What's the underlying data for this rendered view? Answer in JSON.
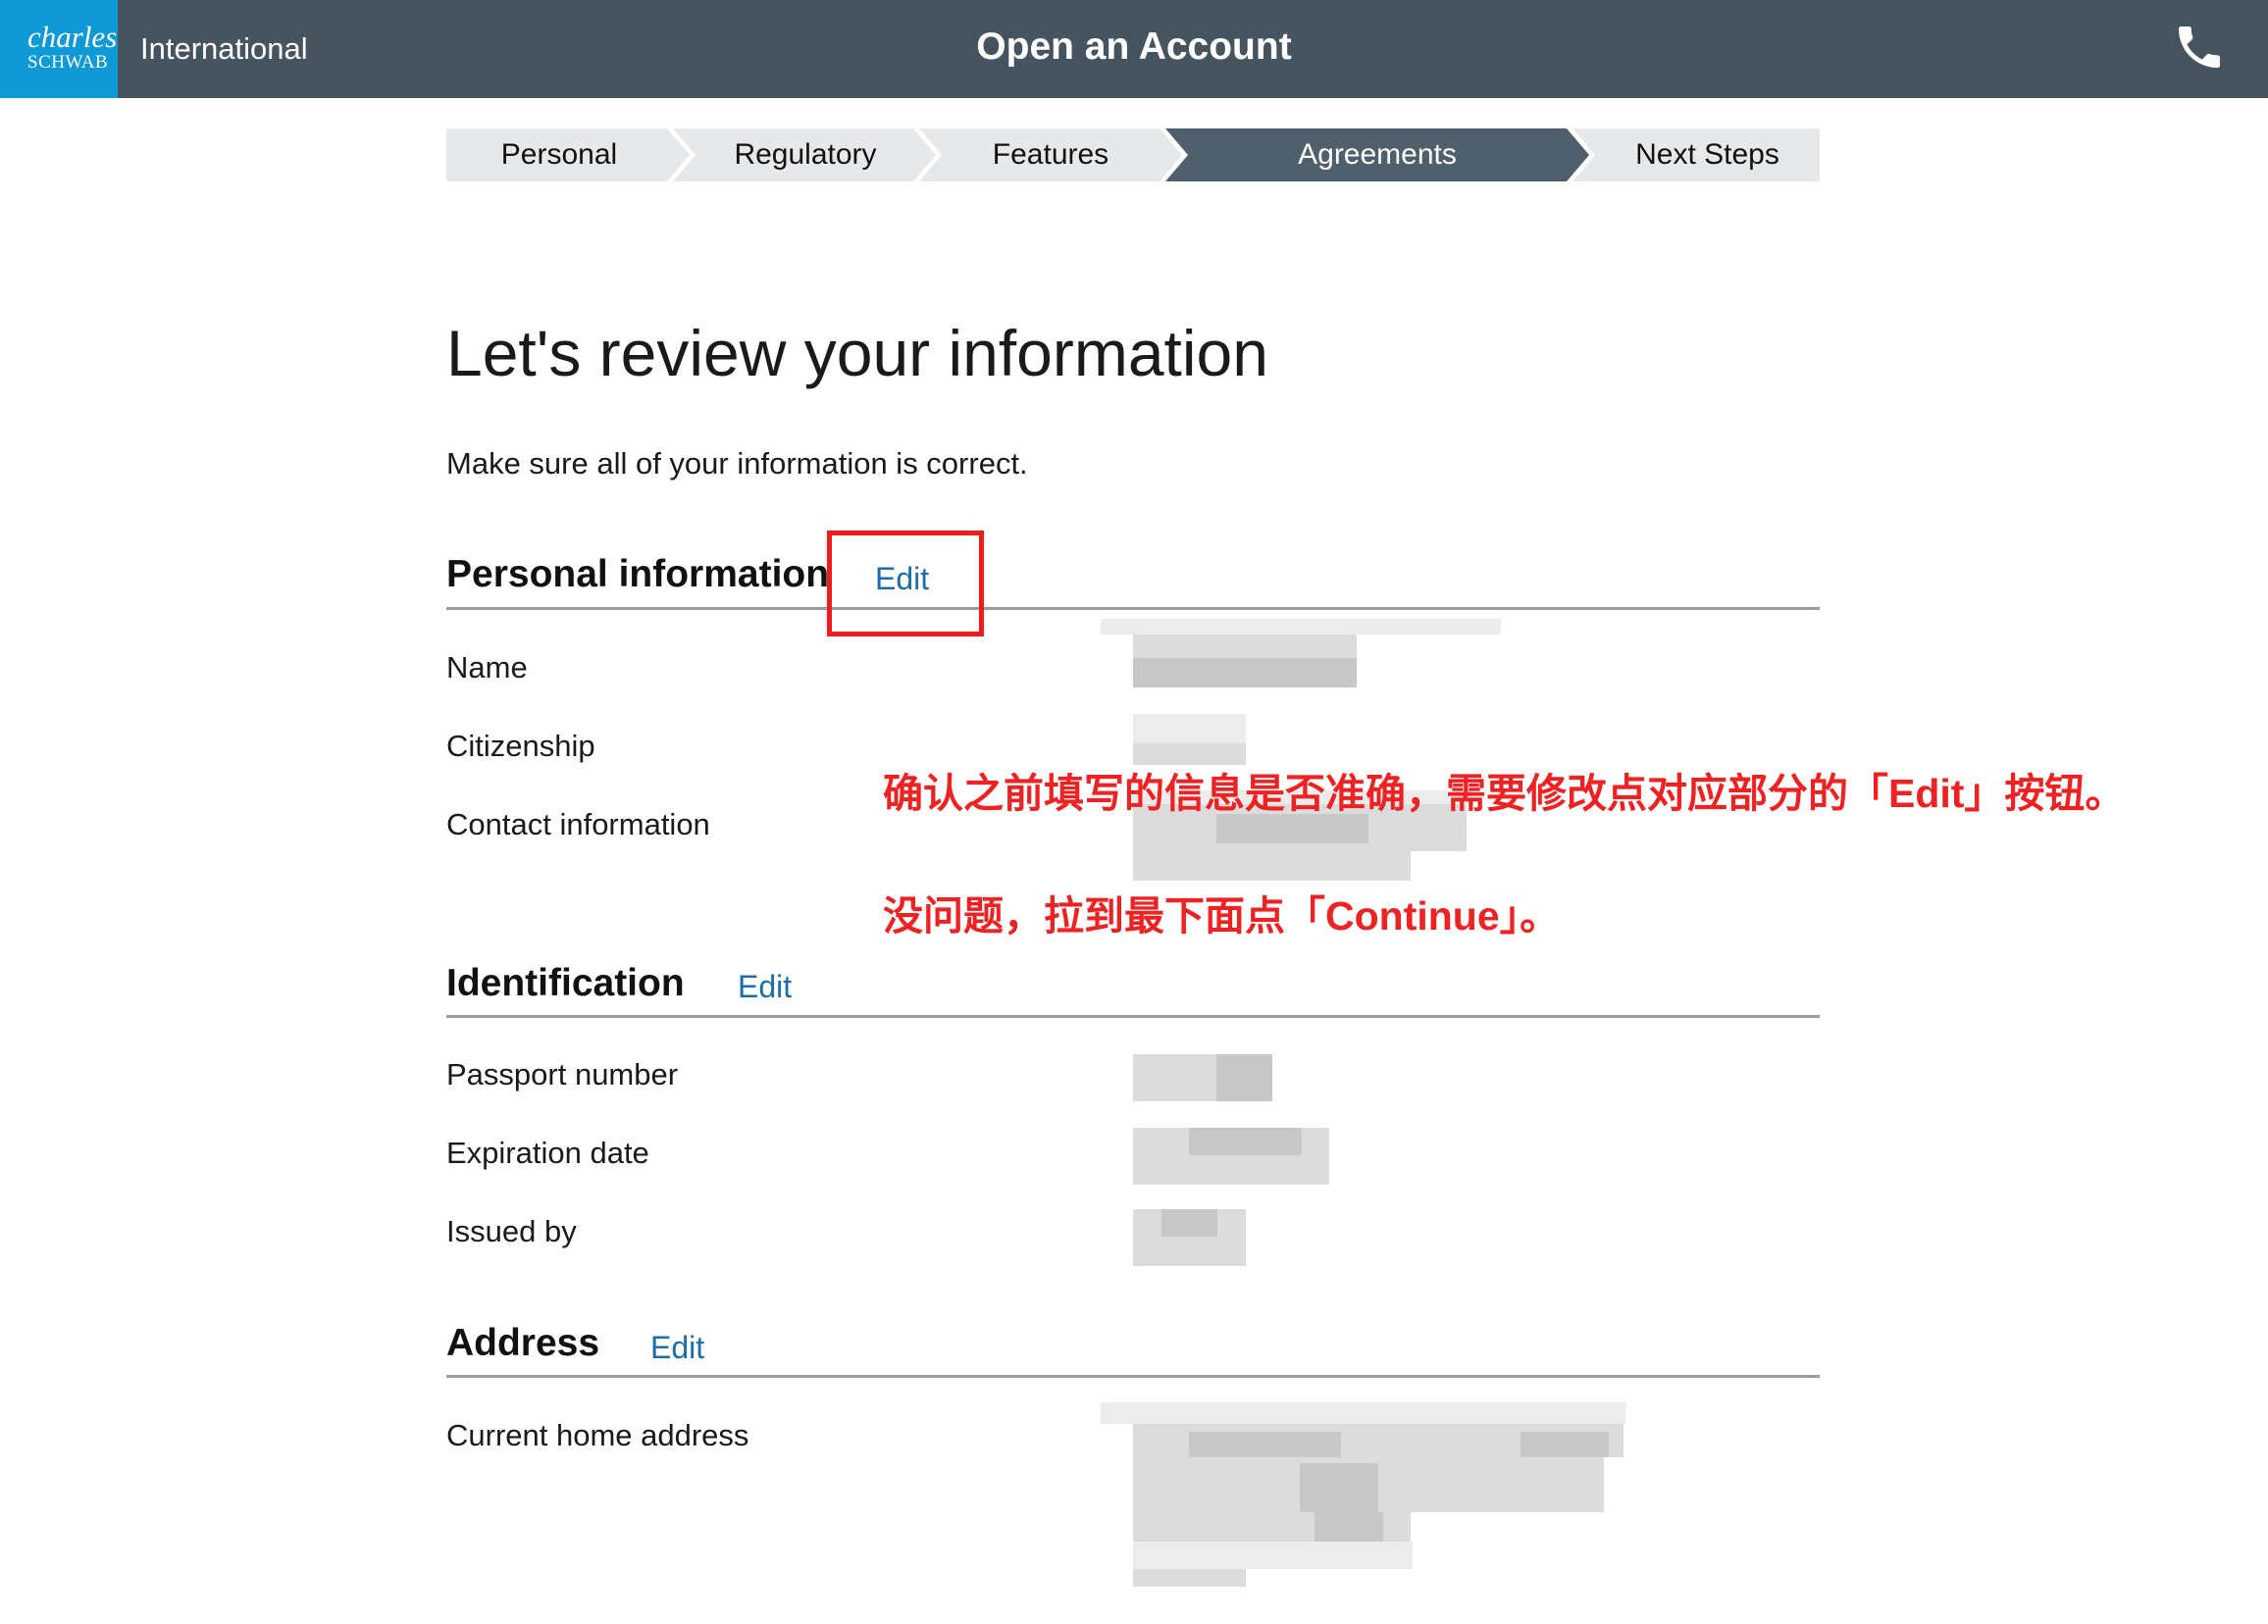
{
  "header": {
    "logo_line1": "charles",
    "logo_line2": "SCHWAB",
    "region": "International",
    "title": "Open an Account",
    "phone_icon": "phone-icon"
  },
  "steps": [
    {
      "label": "Personal",
      "active": false
    },
    {
      "label": "Regulatory",
      "active": false
    },
    {
      "label": "Features",
      "active": false
    },
    {
      "label": "Agreements",
      "active": true
    },
    {
      "label": "Next Steps",
      "active": false
    }
  ],
  "colors": {
    "header_bg": "#45545f",
    "logo_bg": "#0f9ad6",
    "step_inactive": "#e6e8ea",
    "step_active": "#4f5f6b",
    "link": "#1b6ea8",
    "annotation": "#ee2222"
  },
  "main": {
    "heading": "Let's review your information",
    "subheading": "Make sure all of your information is correct."
  },
  "sections": {
    "personal": {
      "title": "Personal information",
      "edit": "Edit",
      "rows": [
        "Name",
        "Citizenship",
        "Contact information"
      ]
    },
    "identification": {
      "title": "Identification",
      "edit": "Edit",
      "rows": [
        "Passport number",
        "Expiration date",
        "Issued by"
      ]
    },
    "address": {
      "title": "Address",
      "edit": "Edit",
      "rows": [
        "Current home address"
      ]
    }
  },
  "annotations": {
    "line1": "确认之前填写的信息是否准确，需要修改点对应部分的「Edit」按钮。",
    "line2": "没问题，拉到最下面点「Continue」。"
  }
}
